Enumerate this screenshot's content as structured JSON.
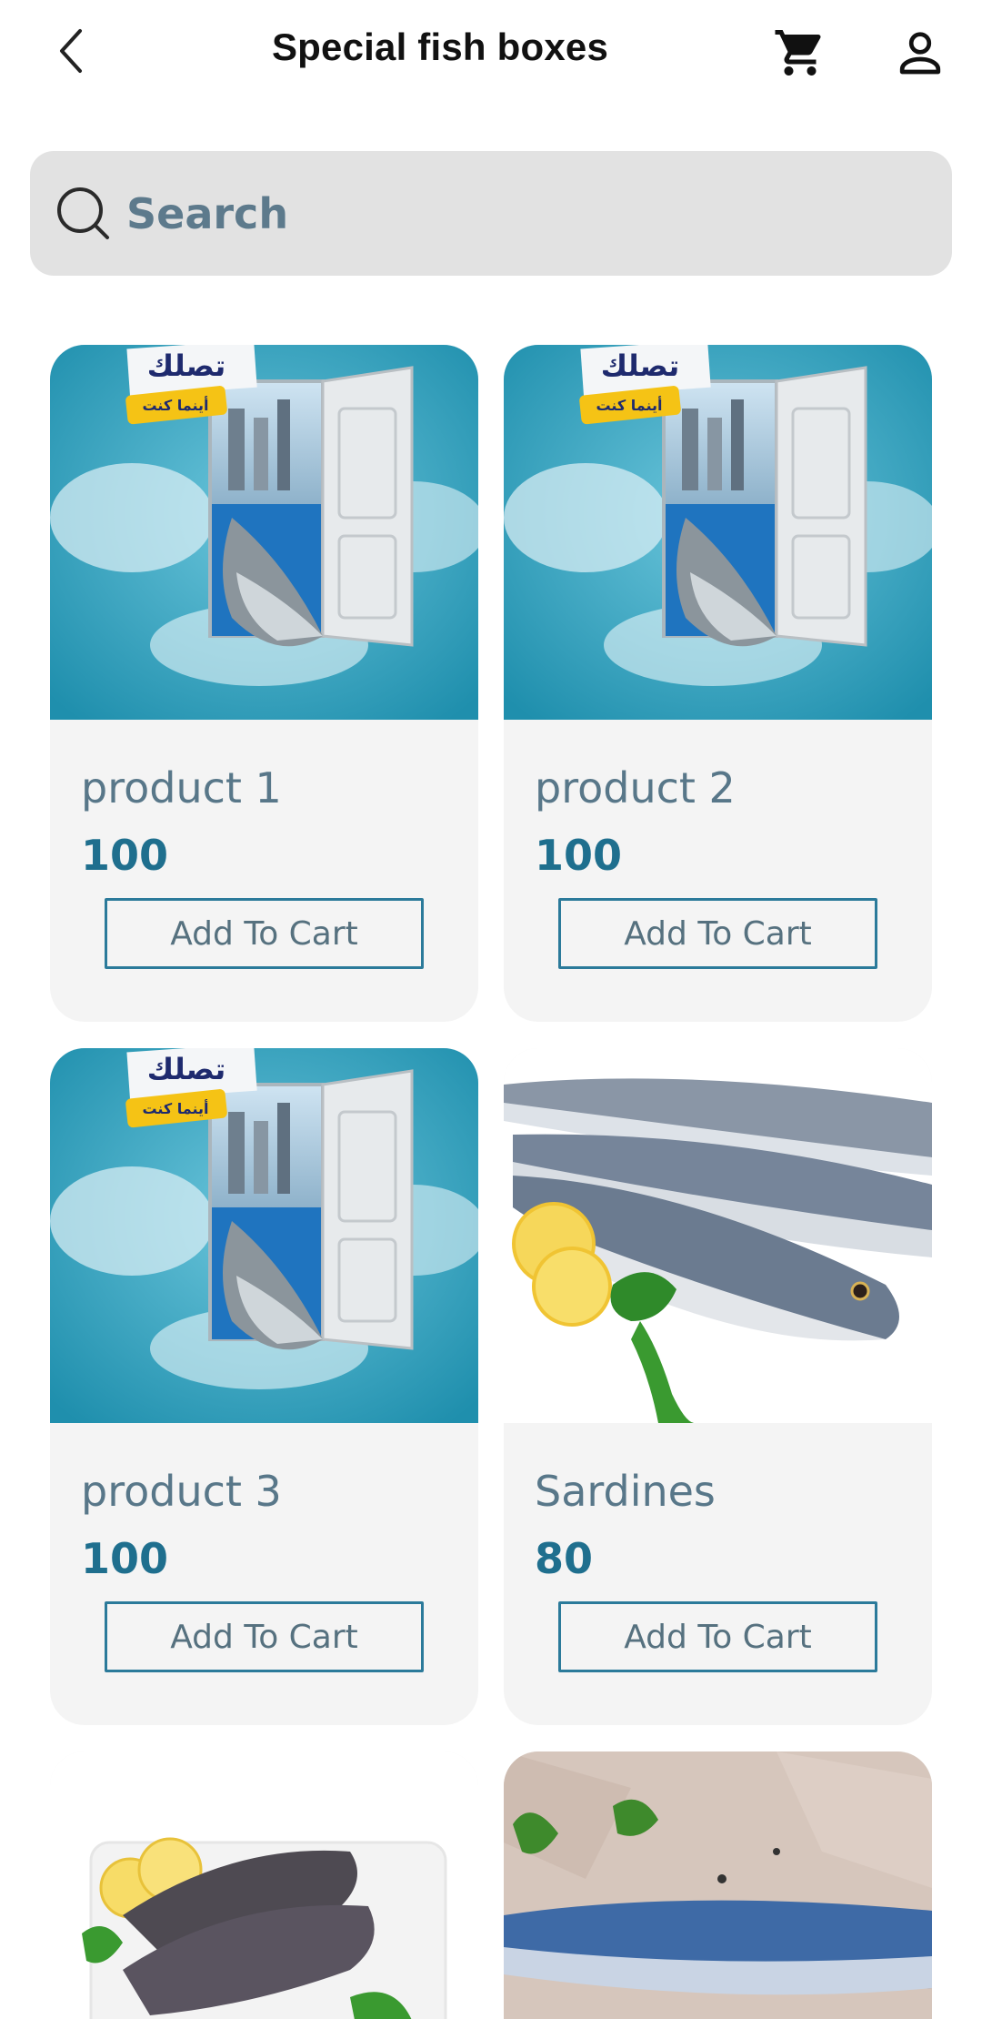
{
  "header": {
    "title": "Special fish boxes"
  },
  "search": {
    "placeholder": "Search"
  },
  "banner": {
    "arabic_top": "تصلك",
    "arabic_tag": "أينما كنت"
  },
  "products": [
    {
      "name": "product 1",
      "price": "100",
      "button": "Add To Cart",
      "image": "promo-door-salmon"
    },
    {
      "name": "product 2",
      "price": "100",
      "button": "Add To Cart",
      "image": "promo-door-salmon"
    },
    {
      "name": "product 3",
      "price": "100",
      "button": "Add To Cart",
      "image": "promo-door-salmon"
    },
    {
      "name": "Sardines",
      "price": "80",
      "button": "Add To Cart",
      "image": "mackerel-lemon"
    },
    {
      "image": "tilapia-plate"
    },
    {
      "image": "blue-fish-paper"
    }
  ],
  "colors": {
    "search_bg": "#e2e2e2",
    "card_bg": "#f4f4f4",
    "name_text": "#587789",
    "price_text": "#1f6f8e",
    "button_border": "#2b7a9a"
  }
}
